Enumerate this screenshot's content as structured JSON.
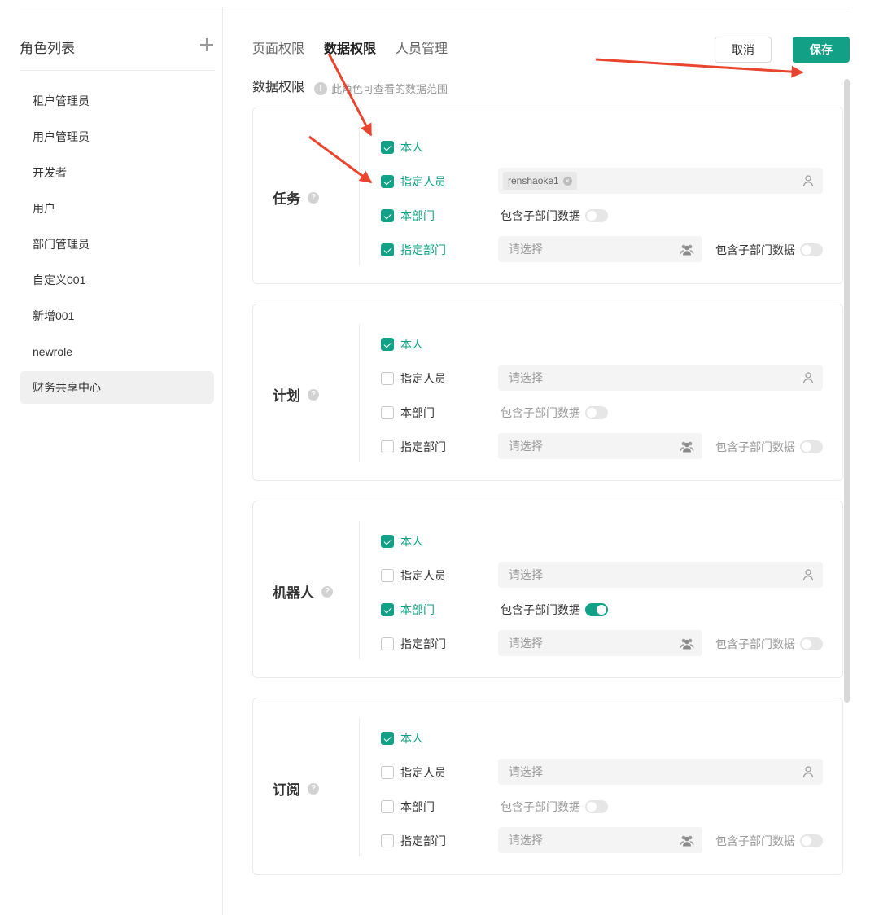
{
  "sidebar": {
    "title": "角色列表",
    "roles": [
      "租户管理员",
      "用户管理员",
      "开发者",
      "用户",
      "部门管理员",
      "自定义001",
      "新增001",
      "newrole",
      "财务共享中心"
    ],
    "active_index": 8
  },
  "tabs": [
    "页面权限",
    "数据权限",
    "人员管理"
  ],
  "active_tab": 1,
  "actions": {
    "cancel": "取消",
    "save": "保存"
  },
  "section": {
    "title": "数据权限",
    "info_icon": "!",
    "hint": "此角色可查看的数据范围"
  },
  "options_labels": {
    "self": "本人",
    "assign_person": "指定人员",
    "own_dept": "本部门",
    "assign_dept": "指定部门"
  },
  "include_sub_label": "包含子部门数据",
  "placeholder": "请选择",
  "help_icon": "?",
  "accent_color": "#12a186",
  "cards": [
    {
      "name": "任务",
      "self": true,
      "assign_person": true,
      "person_tag": "renshaoke1",
      "own_dept": true,
      "own_dept_sub": false,
      "assign_dept": true,
      "assign_dept_sub": false
    },
    {
      "name": "计划",
      "self": true,
      "assign_person": false,
      "person_tag": null,
      "own_dept": false,
      "own_dept_sub": false,
      "assign_dept": false,
      "assign_dept_sub": false
    },
    {
      "name": "机器人",
      "self": true,
      "assign_person": false,
      "person_tag": null,
      "own_dept": true,
      "own_dept_sub": true,
      "assign_dept": false,
      "assign_dept_sub": false
    },
    {
      "name": "订阅",
      "self": true,
      "assign_person": false,
      "person_tag": null,
      "own_dept": false,
      "own_dept_sub": false,
      "assign_dept": false,
      "assign_dept_sub": false
    }
  ]
}
